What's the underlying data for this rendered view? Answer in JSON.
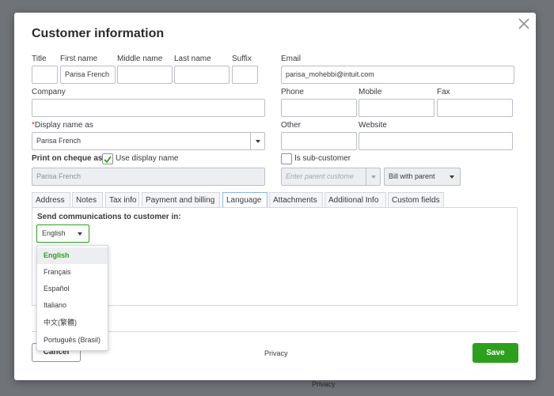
{
  "background": {
    "privacy_text": "Privacy"
  },
  "dialog": {
    "title": "Customer information",
    "close_icon": "close-x-icon"
  },
  "name_fields": {
    "title_label": "Title",
    "title_value": "",
    "first_name_label": "First name",
    "first_name_value": "Parisa French",
    "middle_name_label": "Middle name",
    "middle_name_value": "",
    "last_name_label": "Last name",
    "last_name_value": "",
    "suffix_label": "Suffix",
    "suffix_value": ""
  },
  "company": {
    "label": "Company",
    "value": ""
  },
  "display_name": {
    "required_mark": "*",
    "label": "Display name as",
    "value": "Parisa French"
  },
  "print_on_cheque": {
    "label": "Print on cheque as",
    "checkbox_label": "Use display name",
    "checked": true,
    "value": "Parisa French"
  },
  "email": {
    "label": "Email",
    "value": "parisa_mohebbi@intuit.com"
  },
  "phone": {
    "label": "Phone",
    "value": ""
  },
  "mobile": {
    "label": "Mobile",
    "value": ""
  },
  "fax": {
    "label": "Fax",
    "value": ""
  },
  "other": {
    "label": "Other",
    "value": ""
  },
  "website": {
    "label": "Website",
    "value": ""
  },
  "sub_customer": {
    "checkbox_label": "Is sub-customer",
    "checked": false,
    "parent_placeholder": "Enter parent custome",
    "bill_with": "Bill with parent"
  },
  "tabs": [
    {
      "label": "Address"
    },
    {
      "label": "Notes"
    },
    {
      "label": "Tax info"
    },
    {
      "label": "Payment and billing"
    },
    {
      "label": "Language"
    },
    {
      "label": "Attachments"
    },
    {
      "label": "Additional Info"
    },
    {
      "label": "Custom fields"
    }
  ],
  "active_tab": "Language",
  "language": {
    "heading": "Send communications to customer in:",
    "selected": "English",
    "options": [
      "English",
      "Français",
      "Español",
      "Italiano",
      "中文(繁體)",
      "Português (Brasil)"
    ]
  },
  "footer": {
    "cancel_label": "Cancel",
    "privacy_text": "Privacy",
    "save_label": "Save"
  },
  "colors": {
    "accent_green": "#2ca01c",
    "active_tab_border": "#8ab4e6",
    "required_red": "#d52b1e",
    "backdrop": "#6f7278"
  }
}
